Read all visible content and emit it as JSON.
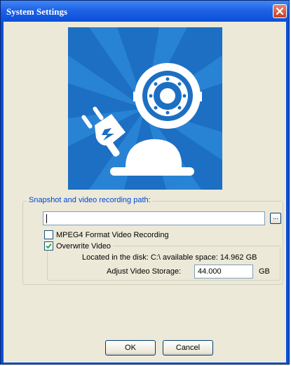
{
  "window": {
    "title": "System Settings"
  },
  "path_group": {
    "label": "Snapshot and video recording path:",
    "path_value": "",
    "browse_label": "...",
    "mpeg4_label": "MPEG4 Format Video Recording",
    "mpeg4_checked": false,
    "overwrite_label": "Overwrite Video",
    "overwrite_checked": true,
    "disk_info": "Located in the disk: C:\\ available space: 14.962 GB",
    "storage_label": "Adjust Video Storage:",
    "storage_value": "44.000",
    "storage_unit": "GB"
  },
  "buttons": {
    "ok": "OK",
    "cancel": "Cancel"
  },
  "colors": {
    "hero_bg": "#1c6fc2",
    "titlebar": "#0a4fd8",
    "group_label": "#0046d5"
  },
  "icons": {
    "hero": "webcam-plug-illustration",
    "close": "close-icon",
    "check": "checkmark-icon"
  }
}
